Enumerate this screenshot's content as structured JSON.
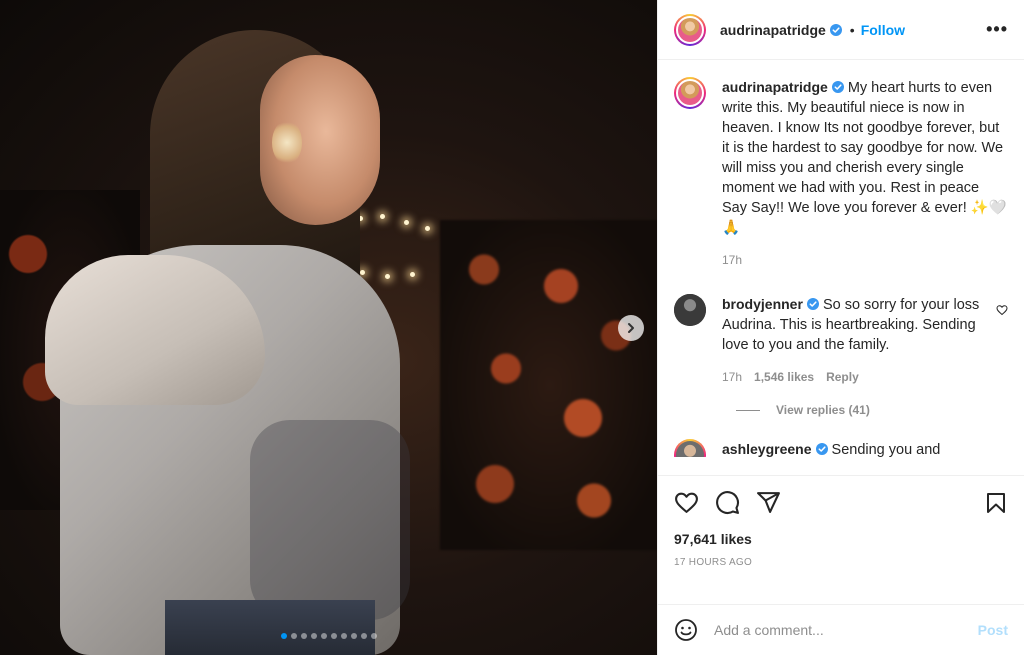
{
  "post": {
    "author": "audrinapatridge",
    "follow_label": "Follow",
    "separator": "•",
    "more_label": "•••",
    "carousel": {
      "slides": 10,
      "active_index": 0
    }
  },
  "caption": {
    "author": "audrinapatridge",
    "text": "My heart hurts to even write this. My beautiful niece is now in heaven. I know Its not goodbye forever, but it is the hardest to say goodbye for now. We will miss you and cherish every single moment we had with you. Rest in peace Say Say!! We love you forever & ever! ✨🤍🙏",
    "time": "17h"
  },
  "comments": [
    {
      "author": "brodyjenner",
      "text": "So so sorry for your loss Audrina. This is heartbreaking. Sending love to you and the family.",
      "time": "17h",
      "likes": "1,546 likes",
      "reply_label": "Reply",
      "view_replies": "View replies (41)"
    },
    {
      "author": "ashleygreene",
      "text": "Sending you and"
    }
  ],
  "stats": {
    "likes": "97,641 likes",
    "posted": "17 HOURS AGO"
  },
  "composer": {
    "placeholder": "Add a comment...",
    "post_label": "Post"
  },
  "colors": {
    "link_blue": "#0095f6",
    "post_disabled": "#b2dffc",
    "muted": "#8e8e8e"
  }
}
